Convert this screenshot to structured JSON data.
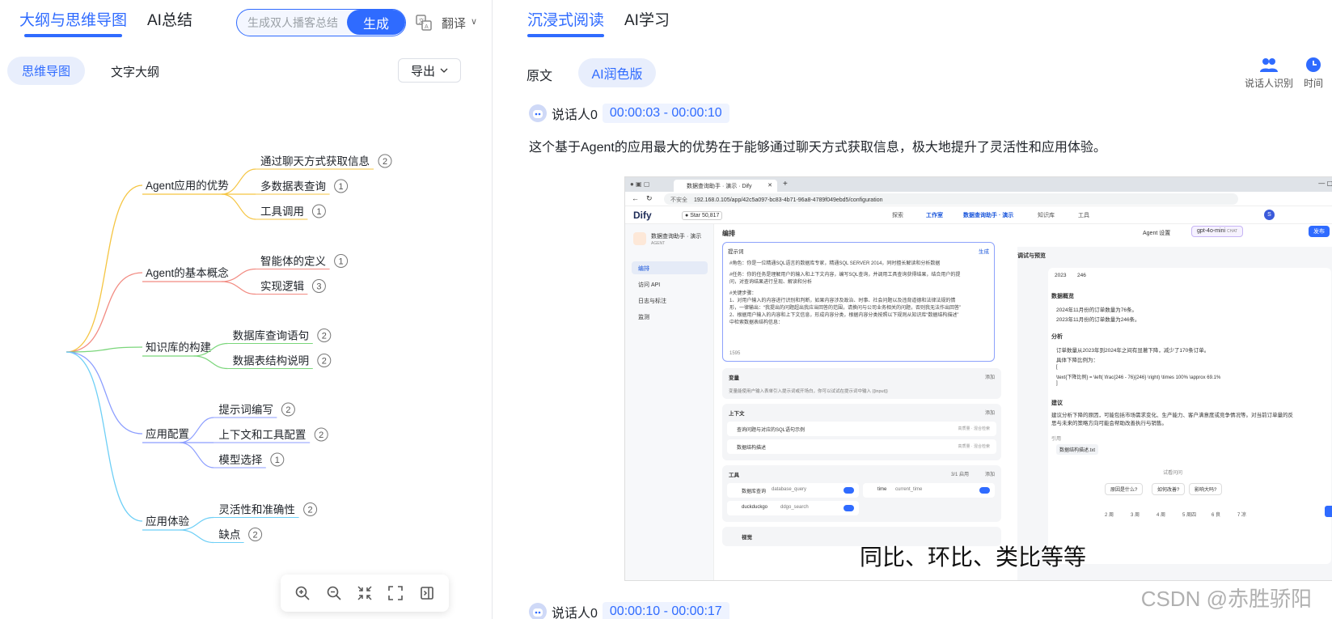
{
  "left": {
    "tabs": [
      {
        "label": "大纲与思维导图",
        "active": true
      },
      {
        "label": "AI总结",
        "active": false
      }
    ],
    "search": {
      "placeholder": "生成双人播客总结",
      "button": "生成"
    },
    "translate": "翻译",
    "sub_tabs": [
      {
        "label": "思维导图",
        "active": true
      },
      {
        "label": "文字大纲",
        "active": false
      }
    ],
    "export": "导出",
    "mindmap": {
      "branches": [
        {
          "label": "Agent应用的优势",
          "color": "#f5c542",
          "children": [
            {
              "label": "通过聊天方式获取信息",
              "count": "2"
            },
            {
              "label": "多数据表查询",
              "count": "1"
            },
            {
              "label": "工具调用",
              "count": "1"
            }
          ]
        },
        {
          "label": "Agent的基本概念",
          "color": "#f28b82",
          "children": [
            {
              "label": "智能体的定义",
              "count": "1"
            },
            {
              "label": "实现逻辑",
              "count": "3"
            }
          ]
        },
        {
          "label": "知识库的构建",
          "color": "#7bd67b",
          "children": [
            {
              "label": "数据库查询语句",
              "count": "2"
            },
            {
              "label": "数据表结构说明",
              "count": "2"
            }
          ]
        },
        {
          "label": "应用配置",
          "color": "#8c9eff",
          "children": [
            {
              "label": "提示词编写",
              "count": "2"
            },
            {
              "label": "上下文和工具配置",
              "count": "2"
            },
            {
              "label": "模型选择",
              "count": "1"
            }
          ]
        },
        {
          "label": "应用体验",
          "color": "#6ecff6",
          "children": [
            {
              "label": "灵活性和准确性",
              "count": "2"
            },
            {
              "label": "缺点",
              "count": "2"
            }
          ]
        }
      ]
    }
  },
  "right": {
    "tabs": [
      {
        "label": "沉浸式阅读",
        "active": true
      },
      {
        "label": "AI学习",
        "active": false
      }
    ],
    "versions": [
      {
        "label": "原文",
        "active": false
      },
      {
        "label": "AI润色版",
        "active": true
      }
    ],
    "tools": [
      {
        "label": "说话人识别",
        "icon": "users-icon"
      },
      {
        "label": "时间",
        "icon": "clock-icon"
      }
    ],
    "segments": [
      {
        "speaker": "说话人0",
        "time": "00:00:03 - 00:00:10",
        "text": "这个基于Agent的应用最大的优势在于能够通过聊天方式获取信息，极大地提升了灵活性和应用体验。"
      },
      {
        "speaker": "说话人0",
        "time": "00:00:10 - 00:00:17"
      }
    ],
    "screenshot": {
      "browser_tab": "数据查询助手 · 演示 · Dify",
      "url": "192.168.0.105/app/42c5a097-bc83-4b71-96a8-4789f049ebd5/configuration",
      "url_prefix": "不安全",
      "app_name": "Dify",
      "github_star": "Star",
      "star_count": "50,817",
      "nav": [
        "探索",
        "工作室",
        "数据查询助手 · 演示",
        "知识库",
        "工具"
      ],
      "app_title": "数据查询助手 · 演示",
      "app_type": "AGENT",
      "side_items": [
        "编排",
        "访问 API",
        "日志与标注",
        "监测"
      ],
      "section_title": "编排",
      "agent_settings": "Agent 设置",
      "model": "gpt-4o-mini",
      "model_tag": "CHAT",
      "publish": "发布",
      "prompt_label": "提示词",
      "prompt_generate": "生成",
      "prompt_lines": [
        "#角色：你是一位精通SQL语言的数据库专家，精通SQL SERVER 2014，同时擅长解读和分析数据",
        "#任务：你的任务是理解用户的输入和上下文内容，编写SQL查询，并调用工具查询获得结果，结合用户的提",
        "问，对查询结果进行呈现、解读和分析",
        "#关键步骤：",
        "1、对用户输入的内容进行识别和判断，如果内容涉及政治、时事、社会问题以及违背道德和法律法规的情",
        "形，一律输出：“我提出的问题超出我应当回答的范围，请换问与公司业务相关的问题，否则我无法作出回答”",
        "2、根据用户输入的内容和上下文信息，形成内容分类，根据内容分类按照以下规则从知识库“数据结构描述”",
        "中检索数据表结构信息："
      ],
      "prompt_count": "1595",
      "var_label": "变量",
      "var_desc": "变量能使用户输入表单引入提示词或开场白，你可以试试在提示词中输入 {{input}}",
      "add": "添加",
      "ctx_label": "上下文",
      "ctx_items": [
        "查询问题与对应的SQL语句示例",
        "数据结构描述"
      ],
      "ctx_meta": "高质量 · 混合检索",
      "tools_label": "工具",
      "tools_enabled": "3/1 启用",
      "tool_items": [
        {
          "name": "数据库查询",
          "id": "database_query"
        },
        {
          "name": "time",
          "id": "current_time"
        },
        {
          "name": "duckduckgo",
          "id": "ddgo_search"
        }
      ],
      "vision_label": "视觉",
      "debug_title": "调试与预览",
      "debug_row": [
        "2023",
        "246"
      ],
      "h_overview": "数据概览",
      "overview": [
        "2024年11月份的订单数量为76条。",
        "2023年11月份的订单数量为246条。"
      ],
      "h_analysis": "分析",
      "analysis": [
        "订单数量从2023年到2024年之间有显著下降，减少了170条订单。",
        "具体下降比例为："
      ],
      "formula_open": "[",
      "formula": "\\text{下降比例} = \\left( \\frac{246 - 76}{246} \\right) \\times 100% \\approx 69.1%",
      "formula_close": "]",
      "h_suggest": "建议",
      "suggest": "建议分析下降的原因，可能包括市场需求变化、生产能力、客户满意度或竞争情况等。对当前订单量的反思与未来的策略方向可能会帮助改善执行与销售。",
      "cite_label": "引用",
      "cite_item": "数据结构描述.txt",
      "try_ask": "试看问问",
      "suggest_qs": [
        "原因是什么?",
        "如何改善?",
        "影响大吗?"
      ],
      "months": [
        "2 周",
        "3 周",
        "4 周",
        "5 周四",
        "6 良",
        "7 凉"
      ],
      "subtitle": "同比、环比、类比等等"
    },
    "watermark": "CSDN @赤胜骄阳"
  }
}
